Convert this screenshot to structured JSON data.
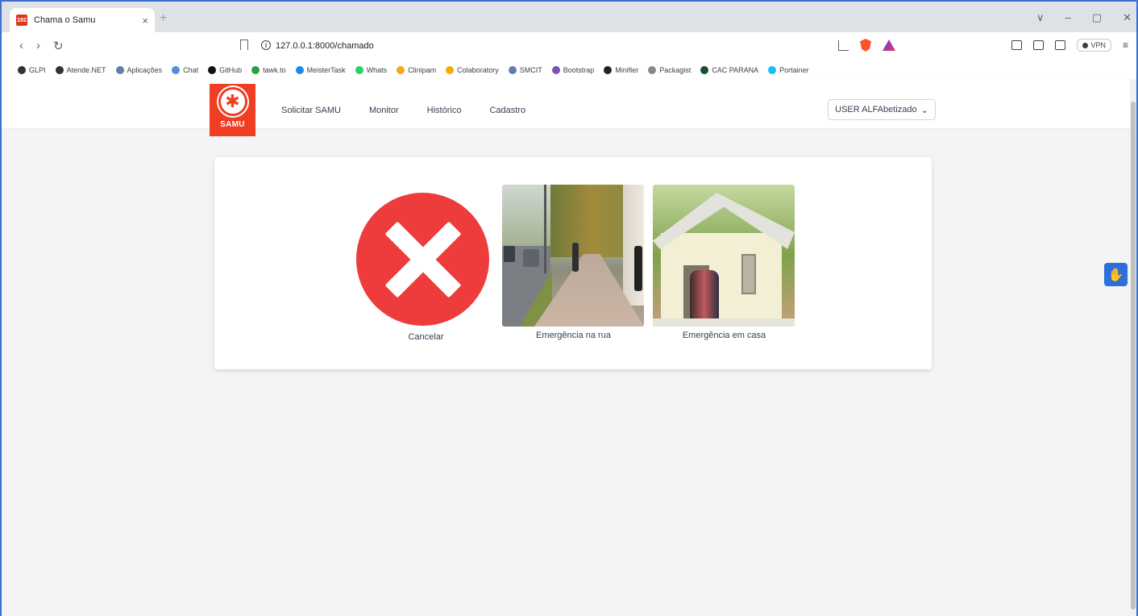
{
  "browser": {
    "tab": {
      "favicon_text": "192",
      "title": "Chama o Samu",
      "close": "×"
    },
    "new_tab": "+",
    "window_controls": [
      "∨",
      "–",
      "▢",
      "✕"
    ],
    "nav": {
      "back": "‹",
      "forward": "›",
      "reload": "↻"
    },
    "url": "127.0.0.1:8000/chamado",
    "url_info_icon": "i",
    "vpn_label": "VPN",
    "menu": "≡",
    "bookmarks": [
      {
        "label": "GLPI",
        "color": "#333333"
      },
      {
        "label": "Atende.NET",
        "color": "#333333"
      },
      {
        "label": "Aplicações",
        "color": "#5f7fa8"
      },
      {
        "label": "Chat",
        "color": "#4e8fd6"
      },
      {
        "label": "GitHub",
        "color": "#111111"
      },
      {
        "label": "tawk.to",
        "color": "#2f9e43"
      },
      {
        "label": "MeisterTask",
        "color": "#1e88e5"
      },
      {
        "label": "Whats",
        "color": "#25d366"
      },
      {
        "label": "Clinipam",
        "color": "#f5a623"
      },
      {
        "label": "Colaboratory",
        "color": "#f9ab00"
      },
      {
        "label": "SMCIT",
        "color": "#5f7fa8"
      },
      {
        "label": "Bootstrap",
        "color": "#7952b3"
      },
      {
        "label": "Minifier",
        "color": "#222222"
      },
      {
        "label": "Packagist",
        "color": "#8a8a8a"
      },
      {
        "label": "CAC PARANA",
        "color": "#1a4d2e"
      },
      {
        "label": "Portainer",
        "color": "#13bef9"
      }
    ]
  },
  "app": {
    "logo_text": "SAMU",
    "logo_symbol": "✱",
    "nav_links": [
      "Solicitar SAMU",
      "Monitor",
      "Histórico",
      "Cadastro"
    ],
    "user": "USER ALFAbetizado",
    "user_caret": "⌄",
    "options": {
      "cancel": "Cancelar",
      "street": "Emergência na rua",
      "home": "Emergência em casa"
    },
    "accessibility_icon": "✋"
  },
  "colors": {
    "brand_red": "#ef3e23",
    "cancel_red": "#ee3b3b",
    "accessibility_blue": "#2d6edb",
    "page_bg": "#f3f4f6"
  }
}
